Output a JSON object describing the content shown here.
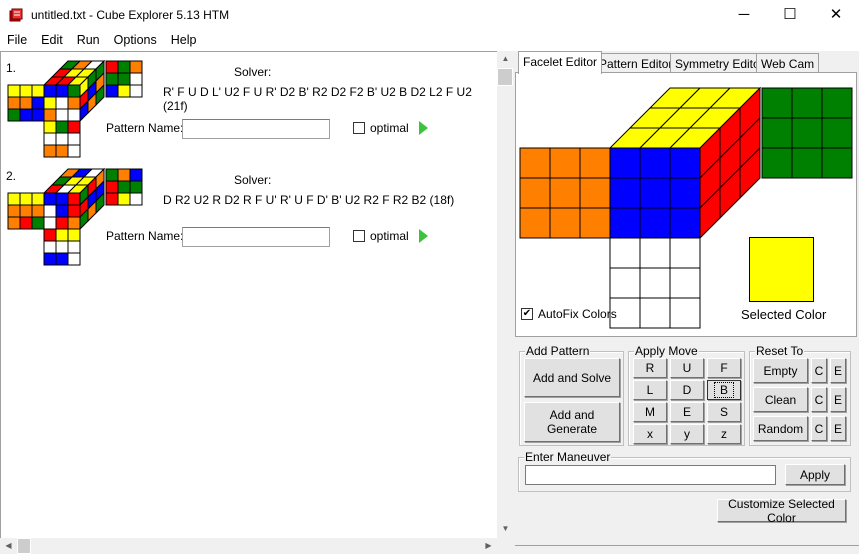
{
  "window": {
    "title": "untitled.txt - Cube Explorer 5.13 HTM",
    "minimize": "─",
    "maximize": "☐",
    "close": "✕"
  },
  "menu": [
    "File",
    "Edit",
    "Run",
    "Options",
    "Help"
  ],
  "patterns": [
    {
      "index": "1.",
      "solver_label": "Solver:",
      "solution": "R' F U D L' U2 F U R' D2 B' R2 D2 F2 B' U2 B D2 L2 F U2  (21f)",
      "pattern_name_label": "Pattern Name:",
      "pattern_name": "",
      "optimal_label": "optimal",
      "optimal": false,
      "cube": {
        "left": [
          "#ffff00",
          "#ffff00",
          "#ffff00",
          "#ff8000",
          "#ff8000",
          "#0000ff",
          "#008000",
          "#0000ff",
          "#0000ff"
        ],
        "front": [
          "#0000ff",
          "#0000ff",
          "#008000",
          "#ffff00",
          "#ffffff",
          "#ff8000",
          "#ff8000",
          "#ffffff",
          "#ffffff"
        ],
        "down": [
          "#ffff00",
          "#008000",
          "#ff0000",
          "#ffffff",
          "#ffffff",
          "#ffffff",
          "#ff8000",
          "#ff8000",
          "#ffffff"
        ],
        "back": [
          "#ff0000",
          "#008000",
          "#ff8000",
          "#008000",
          "#008000",
          "#ffffff",
          "#0000ff",
          "#ffff00",
          "#ffffff"
        ],
        "top": [
          "#008000",
          "#ff8000",
          "#ffffff",
          "#ff0000",
          "#ffff00",
          "#ffff00",
          "#ff0000",
          "#ff0000",
          "#ffff00"
        ],
        "right": [
          "#ffff00",
          "#008000",
          "#008000",
          "#ff0000",
          "#0000ff",
          "#ff8000",
          "#0000ff",
          "#ff8000",
          "#008000"
        ]
      }
    },
    {
      "index": "2.",
      "solver_label": "Solver:",
      "solution": "D R2 U2 R D2 R F U' R' U F D' B' U2 R2 F R2 B2  (18f)",
      "pattern_name_label": "Pattern Name:",
      "pattern_name": "",
      "optimal_label": "optimal",
      "optimal": false,
      "cube": {
        "left": [
          "#ffff00",
          "#ffff00",
          "#ffff00",
          "#ff8000",
          "#ff8000",
          "#ff8000",
          "#ff8000",
          "#ff0000",
          "#008000"
        ],
        "front": [
          "#0000ff",
          "#0000ff",
          "#ff0000",
          "#ffffff",
          "#0000ff",
          "#ff0000",
          "#ffffff",
          "#ff0000",
          "#ff8000"
        ],
        "down": [
          "#ff0000",
          "#ffff00",
          "#ffff00",
          "#ffffff",
          "#ffffff",
          "#ffffff",
          "#0000ff",
          "#0000ff",
          "#ffffff"
        ],
        "back": [
          "#008000",
          "#ff8000",
          "#0000ff",
          "#ff0000",
          "#008000",
          "#008000",
          "#ff0000",
          "#ffff00",
          "#ffffff"
        ],
        "top": [
          "#ff8000",
          "#0000ff",
          "#ffffff",
          "#008000",
          "#ffff00",
          "#ffff00",
          "#ff0000",
          "#ffffff",
          "#ffff00"
        ],
        "right": [
          "#008000",
          "#ff0000",
          "#ff8000",
          "#ff0000",
          "#0000ff",
          "#0000ff",
          "#008000",
          "#ff8000",
          "#008000"
        ]
      }
    }
  ],
  "tabs": [
    {
      "label": "Facelet Editor",
      "active": true
    },
    {
      "label": "Pattern Editor"
    },
    {
      "label": "Symmetry Editor"
    },
    {
      "label": "Web Cam"
    }
  ],
  "editor": {
    "cube": {
      "left": [
        "#ff8000",
        "#ff8000",
        "#ff8000",
        "#ff8000",
        "#ff8000",
        "#ff8000",
        "#ff8000",
        "#ff8000",
        "#ff8000"
      ],
      "front": [
        "#0000ff",
        "#0000ff",
        "#0000ff",
        "#0000ff",
        "#0000ff",
        "#0000ff",
        "#0000ff",
        "#0000ff",
        "#0000ff"
      ],
      "down": [
        "#ffffff",
        "#ffffff",
        "#ffffff",
        "#ffffff",
        "#ffffff",
        "#ffffff",
        "#ffffff",
        "#ffffff",
        "#ffffff"
      ],
      "back": [
        "#008000",
        "#008000",
        "#008000",
        "#008000",
        "#008000",
        "#008000",
        "#008000",
        "#008000",
        "#008000"
      ],
      "top": [
        "#ffff00",
        "#ffff00",
        "#ffff00",
        "#ffff00",
        "#ffff00",
        "#ffff00",
        "#ffff00",
        "#ffff00",
        "#ffff00"
      ],
      "right": [
        "#ff0000",
        "#ff0000",
        "#ff0000",
        "#ff0000",
        "#ff0000",
        "#ff0000",
        "#ff0000",
        "#ff0000",
        "#ff0000"
      ]
    },
    "autofix_label": "AutoFix Colors",
    "autofix": true,
    "selected_color_label": "Selected Color",
    "selected_color": "#ffff00"
  },
  "add_pattern": {
    "label": "Add Pattern",
    "solve": "Add and Solve",
    "generate": "Add and Generate"
  },
  "apply_move": {
    "label": "Apply Move",
    "moves": [
      "R",
      "U",
      "F",
      "L",
      "D",
      "B",
      "M",
      "E",
      "S",
      "x",
      "y",
      "z"
    ],
    "focused": "B"
  },
  "reset_to": {
    "label": "Reset To",
    "rows": [
      "Empty",
      "Clean",
      "Random"
    ],
    "c": "C",
    "e": "E"
  },
  "maneuver": {
    "label": "Enter Maneuver",
    "value": "",
    "apply": "Apply"
  },
  "customize": "Customize Selected Color"
}
